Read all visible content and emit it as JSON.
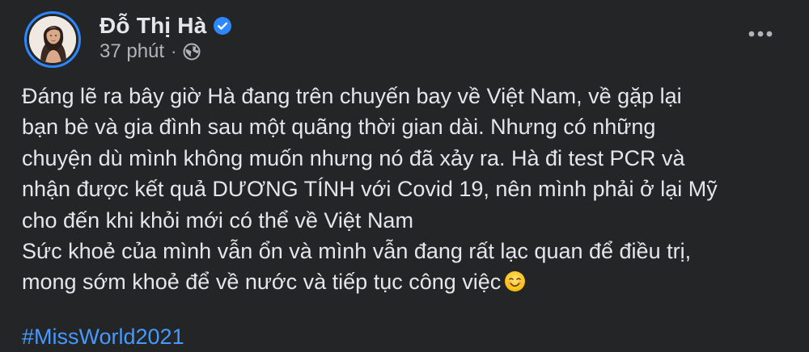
{
  "post": {
    "author": "Đỗ Thị Hà",
    "time": "37 phút",
    "separator": "·",
    "privacy_icon": "globe-icon",
    "verified_icon": "verified-badge-icon",
    "more_icon": "more-options-icon",
    "body_lines": [
      "Đáng lẽ ra bây giờ Hà đang trên chuyến bay về Việt Nam, về gặp lại",
      "bạn bè và gia đình sau một quãng thời gian dài. Nhưng có những",
      "chuyện dù mình không muốn nhưng nó đã xảy ra. Hà đi test PCR và",
      "nhận được kết quả DƯƠNG TÍNH với Covid 19, nên mình phải ở lại Mỹ",
      "cho đến khi khỏi mới có thể về Việt Nam",
      "Sức khoẻ của mình vẫn ổn và mình vẫn đang rất lạc quan để điều trị,",
      "mong sớm khoẻ để về nước và tiếp tục công việc"
    ],
    "emoji": "smiling-face-emoji",
    "hashtag": "#MissWorld2021"
  },
  "colors": {
    "background": "#242526",
    "primary_text": "#e4e6eb",
    "secondary_text": "#b0b3b8",
    "accent": "#2d88ff",
    "hashtag": "#4599ff"
  }
}
